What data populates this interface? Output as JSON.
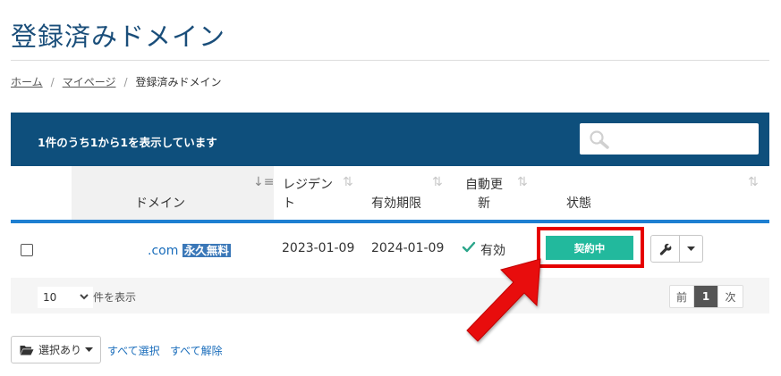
{
  "page": {
    "title": "登録済みドメイン"
  },
  "breadcrumb": {
    "home": "ホーム",
    "separator": "/",
    "mypage": "マイページ",
    "current": "登録済みドメイン"
  },
  "table": {
    "info": "1件のうち1から1を表示しています",
    "search_placeholder": "",
    "columns": {
      "domain": "ドメイン",
      "registrant_line1": "レジデン",
      "registrant_line2": "ト",
      "expiry": "有効期限",
      "autorenew_line1": "自動更",
      "autorenew_line2": "新",
      "status": "状態"
    },
    "rows": [
      {
        "domain_ext": ".com",
        "domain_tag": "永久無料",
        "registrant_date": "2023-01-09",
        "expiry_date": "2024-01-09",
        "autorenew": "有効",
        "status": "契約中"
      }
    ],
    "footer": {
      "page_length": "10",
      "page_length_label": "件を表示",
      "prev": "前",
      "page": "1",
      "next": "次"
    }
  },
  "bulk": {
    "button_label": "選択あり",
    "select_all": "すべて選択",
    "deselect_all": "すべて解除"
  },
  "colors": {
    "header_bar": "#0e4f7c",
    "title": "#1a4e7a",
    "status_badge": "#22b99d",
    "highlight": "#e60000",
    "accent_rule": "#1e7fd1"
  }
}
